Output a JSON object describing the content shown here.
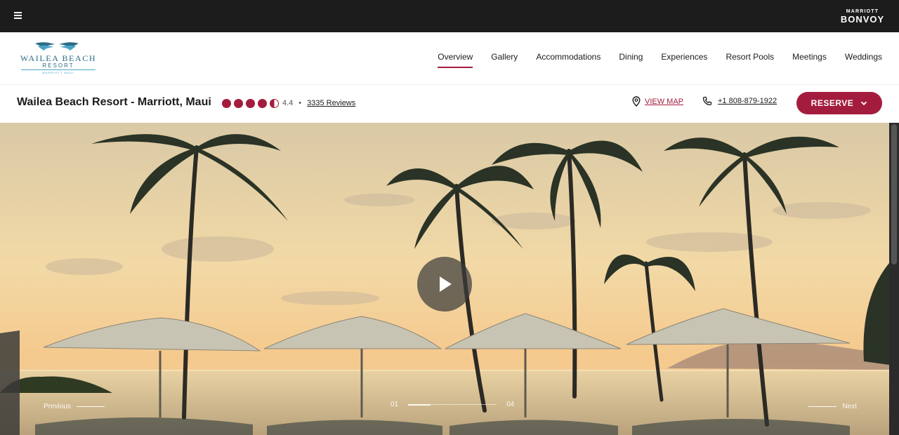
{
  "topbar": {
    "menu_icon": "hamburger-icon",
    "brand_top": "MARRIOTT",
    "brand_bottom": "BONVOY"
  },
  "logo": {
    "name": "WAILEA BEACH",
    "sub": "RESORT",
    "tag": "MARRIOTT MAUI"
  },
  "nav": {
    "items": [
      {
        "label": "Overview",
        "active": true
      },
      {
        "label": "Gallery"
      },
      {
        "label": "Accommodations"
      },
      {
        "label": "Dining"
      },
      {
        "label": "Experiences"
      },
      {
        "label": "Resort Pools"
      },
      {
        "label": "Meetings"
      },
      {
        "label": "Weddings"
      }
    ]
  },
  "property": {
    "name": "Wailea Beach Resort - Marriott, Maui",
    "rating": "4.4",
    "rating_value": 4.4,
    "rating_max": 5,
    "separator": "•",
    "reviews": "3335 Reviews",
    "view_map": "VIEW MAP",
    "phone": "+1 808-879-1922",
    "reserve": "RESERVE"
  },
  "hero": {
    "previous": "Previous",
    "next": "Next",
    "page_current": "01",
    "page_total": "04",
    "play_icon": "play-icon"
  },
  "colors": {
    "accent": "#a41c3d",
    "topbar": "#1c1c1c",
    "logo": "#2b6c86"
  }
}
